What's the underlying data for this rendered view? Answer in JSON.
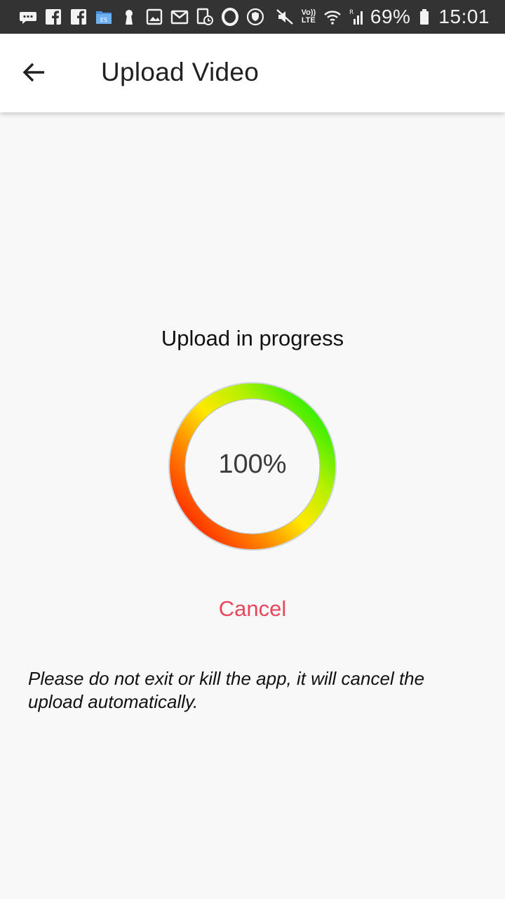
{
  "status_bar": {
    "battery_percent": "69%",
    "time": "15:01",
    "network_label": "Vo)) LTE",
    "roaming_label": "R",
    "icons": [
      "messages-icon",
      "facebook-icon",
      "facebook-icon",
      "file-manager-icon",
      "keyhole-icon",
      "gallery-icon",
      "gmail-icon",
      "calendar-icon",
      "opera-icon",
      "vpn-shield-icon",
      "mute-icon",
      "volte-icon",
      "wifi-icon",
      "signal-icon",
      "battery-icon"
    ]
  },
  "app_bar": {
    "title": "Upload Video",
    "back_icon": "arrow-left-icon"
  },
  "upload": {
    "heading": "Upload in progress",
    "progress_value": "100%",
    "progress_fraction": 1.0,
    "cancel_label": "Cancel",
    "warning": "Please do not exit or kill the app, it will cancel the upload automatically."
  },
  "colors": {
    "accent_cancel": "#e8475b",
    "ring_start": "#ff3b00",
    "ring_mid": "#ffee00",
    "ring_end": "#44ee00",
    "status_bar_bg": "#333333",
    "page_bg": "#f8f8f8"
  }
}
